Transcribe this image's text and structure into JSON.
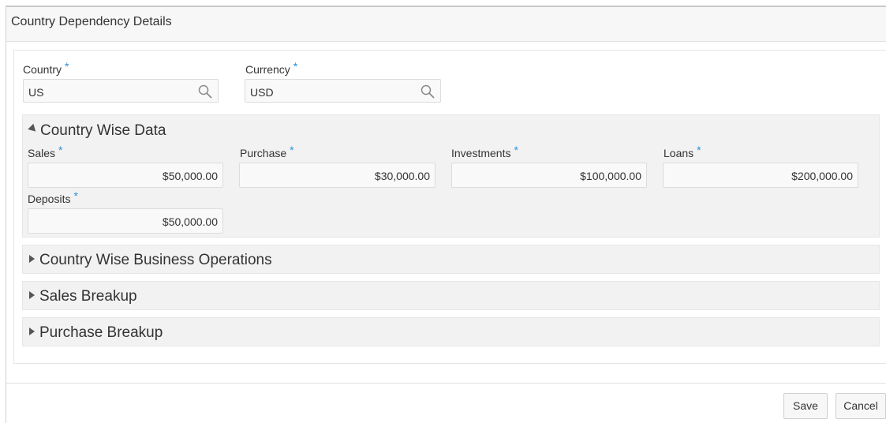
{
  "page": {
    "title": "Country Dependency Details"
  },
  "required_marker": "*",
  "top_fields": {
    "country": {
      "label": "Country",
      "value": "US",
      "icon": "search-icon"
    },
    "currency": {
      "label": "Currency",
      "value": "USD",
      "icon": "search-icon"
    }
  },
  "sections": {
    "country_wise_data": {
      "title": "Country Wise Data",
      "expanded": true,
      "fields": {
        "sales": {
          "label": "Sales",
          "value": "$50,000.00"
        },
        "purchase": {
          "label": "Purchase",
          "value": "$30,000.00"
        },
        "investments": {
          "label": "Investments",
          "value": "$100,000.00"
        },
        "loans": {
          "label": "Loans",
          "value": "$200,000.00"
        },
        "deposits": {
          "label": "Deposits",
          "value": "$50,000.00"
        }
      }
    },
    "business_operations": {
      "title": "Country Wise Business Operations",
      "expanded": false
    },
    "sales_breakup": {
      "title": "Sales Breakup",
      "expanded": false
    },
    "purchase_breakup": {
      "title": "Purchase Breakup",
      "expanded": false
    }
  },
  "footer": {
    "save_label": "Save",
    "cancel_label": "Cancel"
  },
  "colors": {
    "required_asterisk": "#2a8fd8",
    "section_background": "#f2f2f2"
  }
}
